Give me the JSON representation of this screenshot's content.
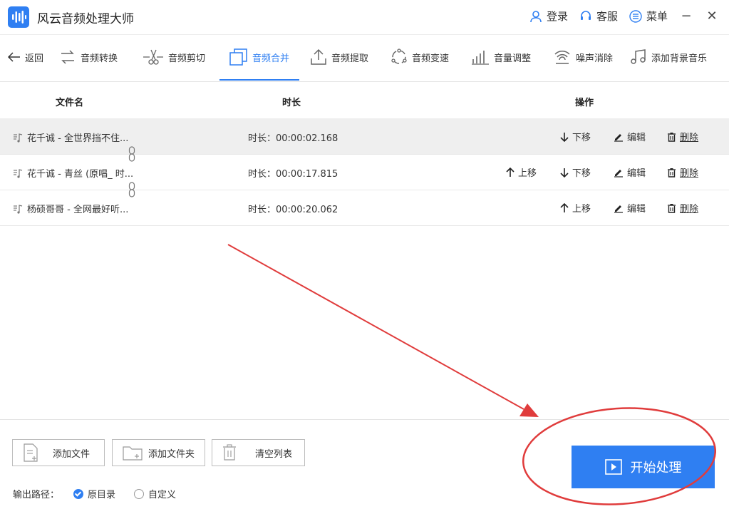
{
  "app": {
    "title": "风云音频处理大师"
  },
  "header_actions": {
    "login": "登录",
    "service": "客服",
    "menu": "菜单"
  },
  "toolbar": {
    "back": "返回",
    "tabs": [
      "音频转换",
      "音频剪切",
      "音频合并",
      "音频提取",
      "音频变速",
      "音量调整",
      "噪声消除",
      "添加背景音乐"
    ],
    "active_tab": "音频合并"
  },
  "table": {
    "headers": {
      "name": "文件名",
      "duration": "时长",
      "ops": "操作"
    },
    "rows": [
      {
        "name": "花千诚 - 全世界挡不住...",
        "duration": "时长：00:00:02.168"
      },
      {
        "name": "花千诚 - 青丝 (原唱_ 时...",
        "duration": "时长：00:00:17.815"
      },
      {
        "name": "杨硕哥哥 - 全网最好听...",
        "duration": "时长：00:00:20.062"
      }
    ],
    "ops": {
      "up": "上移",
      "down": "下移",
      "edit": "编辑",
      "delete": "删除"
    }
  },
  "bottom": {
    "add_file": "添加文件",
    "add_folder": "添加文件夹",
    "clear_list": "清空列表",
    "output_label": "输出路径：",
    "output_options": [
      "原目录",
      "自定义"
    ],
    "selected_output": "原目录",
    "start": "开始处理"
  },
  "colors": {
    "accent": "#2f7ff2",
    "annotation": "#e03c3c",
    "selected_row": "#efefef"
  }
}
